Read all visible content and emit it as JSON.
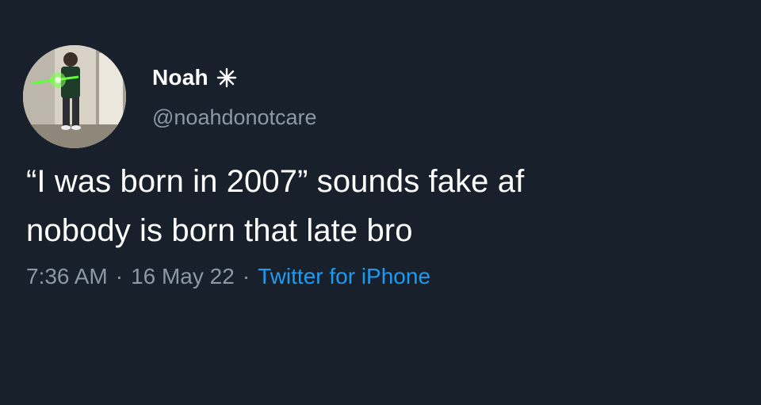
{
  "user": {
    "display_name": "Noah",
    "name_emoji": "sparkle-icon",
    "handle": "@noahdonotcare"
  },
  "tweet": {
    "lines": [
      "“I was born in 2007” sounds fake af",
      "nobody is born that late bro"
    ],
    "time": "7:36 AM",
    "date": "16 May 22",
    "separator": "·",
    "source": "Twitter for iPhone"
  },
  "colors": {
    "background": "#17202b",
    "text": "#ffffff",
    "muted": "#8b98a5",
    "link": "#1d9bf0"
  }
}
